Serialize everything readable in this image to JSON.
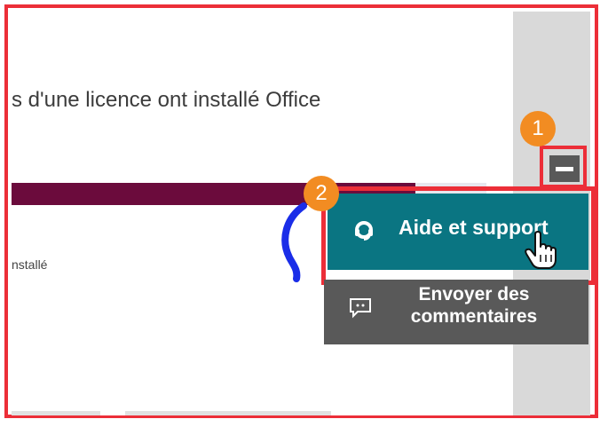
{
  "headline": "s d'une licence ont installé Office",
  "legend_label": "nstallé",
  "menu": {
    "help_label": "Aide et support",
    "feedback_label": "Envoyer des commentaires"
  },
  "callouts": {
    "first": "1",
    "second": "2"
  },
  "icons": {
    "collapse": "minus-icon",
    "help": "headset-icon",
    "feedback": "comment-icon",
    "cursor": "hand-pointer-icon"
  },
  "colors": {
    "highlight_border": "#ec2e38",
    "help_bg": "#0a7582",
    "panel_gray": "#595959",
    "bar_fill": "#6b0b3c",
    "callout": "#f28c22"
  }
}
